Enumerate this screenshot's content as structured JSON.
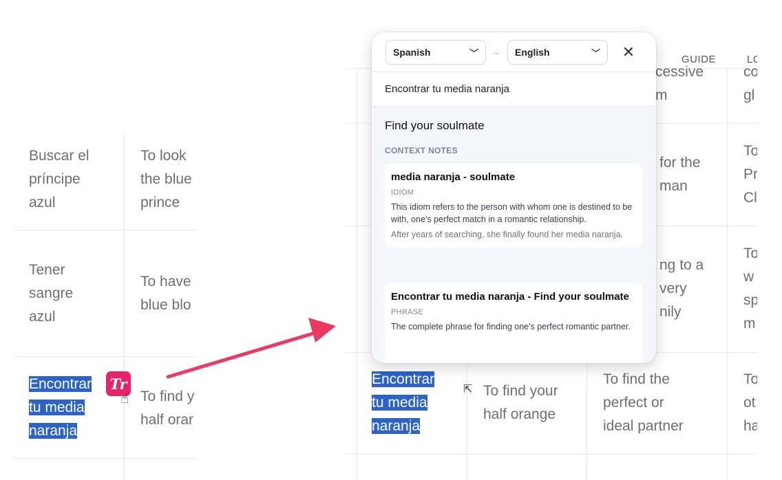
{
  "nav": {
    "guide": "GUIDE",
    "lo": "LO"
  },
  "left_table": {
    "rows": [
      {
        "spanish": [
          "Buscar el",
          "príncipe",
          "azul"
        ],
        "english": [
          "To look",
          "the blue",
          "prince"
        ]
      },
      {
        "spanish": [
          "Tener",
          "sangre",
          "azul"
        ],
        "english": [
          "To have",
          "blue blo"
        ]
      },
      {
        "spanish": [
          "Encontrar",
          "tu media",
          "naranja"
        ],
        "english": [
          "To find y",
          "half orar"
        ]
      }
    ]
  },
  "right_table": {
    "col3": {
      "r1": [
        "cessive",
        "m"
      ],
      "r2": [
        "for the",
        "man"
      ],
      "r3": [
        "ng to a",
        "very",
        "nily"
      ],
      "r4": [
        "To find the",
        "perfect or",
        "ideal partner"
      ]
    },
    "col4": {
      "r1": [
        "co",
        "gl"
      ],
      "r2": [
        "To",
        "Pr",
        "Cl"
      ],
      "r3": [
        "To",
        "w",
        "sp",
        "m"
      ],
      "r4": [
        "To",
        "ot",
        "ha"
      ]
    },
    "row4": {
      "spanish": [
        "Encontrar",
        "tu media",
        "naranja"
      ],
      "english": [
        "To find your",
        "half orange"
      ]
    }
  },
  "popup": {
    "source_lang": "Spanish",
    "target_lang": "English",
    "swap_symbol": "→",
    "close_symbol": "✕",
    "source_text": "Encontrar tu media naranja",
    "translation": "Find your soulmate",
    "context_title": "CONTEXT NOTES",
    "notes": [
      {
        "head": "media naranja - soulmate",
        "type": "IDIOM",
        "desc": "This idiom refers to the person with whom one is destined to be with, one's perfect match in a romantic relationship.",
        "example": "After years of searching, she finally found her media naranja."
      },
      {
        "head": "Encontrar tu media naranja - Find your soulmate",
        "type": "PHRASE",
        "desc": "The complete phrase for finding one's perfect romantic partner."
      }
    ]
  },
  "badge": {
    "label": "Tr"
  },
  "colors": {
    "accent": "#e6246b",
    "highlight": "#2c63c9",
    "arrow": "#ea3a64"
  }
}
